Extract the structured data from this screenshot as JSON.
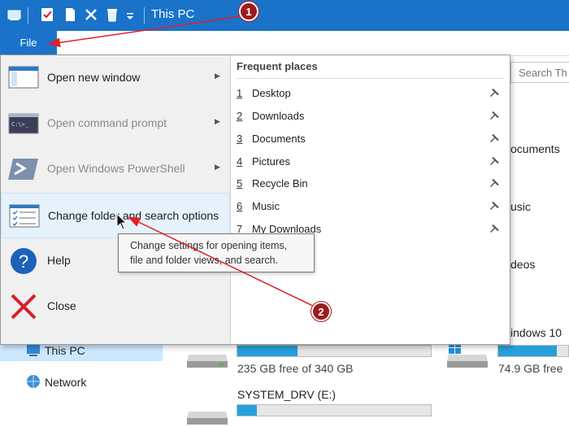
{
  "window": {
    "title": "This PC"
  },
  "ribbon": {
    "file_tab": "File"
  },
  "background": {
    "search_placeholder": "Search Th",
    "nav": {
      "this_pc": "This PC",
      "network": "Network"
    },
    "folders": {
      "documents": "ocuments",
      "music": "usic",
      "videos": "deos"
    },
    "drives": [
      {
        "name": "",
        "free_text": "235 GB free of 340 GB",
        "used_fraction": 0.31
      },
      {
        "name": "indows 10",
        "free_text": "74.9 GB free",
        "used_fraction": 0.84
      },
      {
        "name": "SYSTEM_DRV (E:)",
        "free_text": "",
        "used_fraction": 0.1
      }
    ]
  },
  "file_menu": {
    "items": [
      {
        "label": "Open new window",
        "has_submenu": true,
        "enabled": true
      },
      {
        "label": "Open command prompt",
        "has_submenu": true,
        "enabled": false
      },
      {
        "label": "Open Windows PowerShell",
        "has_submenu": true,
        "enabled": false
      },
      {
        "label": "Change folder and search options",
        "has_submenu": false,
        "enabled": true
      },
      {
        "label": "Help",
        "has_submenu": false,
        "enabled": true
      },
      {
        "label": "Close",
        "has_submenu": false,
        "enabled": true
      }
    ],
    "frequent_places": {
      "title": "Frequent places",
      "items": [
        {
          "num": "1",
          "name": "Desktop"
        },
        {
          "num": "2",
          "name": "Downloads"
        },
        {
          "num": "3",
          "name": "Documents"
        },
        {
          "num": "4",
          "name": "Pictures"
        },
        {
          "num": "5",
          "name": "Recycle Bin"
        },
        {
          "num": "6",
          "name": "Music"
        },
        {
          "num": "7",
          "name": "My Downloads"
        }
      ]
    }
  },
  "tooltip": {
    "line1": "Change settings for opening items,",
    "line2": "file and folder views, and search."
  },
  "annotations": {
    "callout1": "1",
    "callout2": "2"
  },
  "colors": {
    "accent": "#1a73c8",
    "callout": "#9b1c1c",
    "arrow": "#e0202a",
    "drive_bar": "#26a0da"
  }
}
